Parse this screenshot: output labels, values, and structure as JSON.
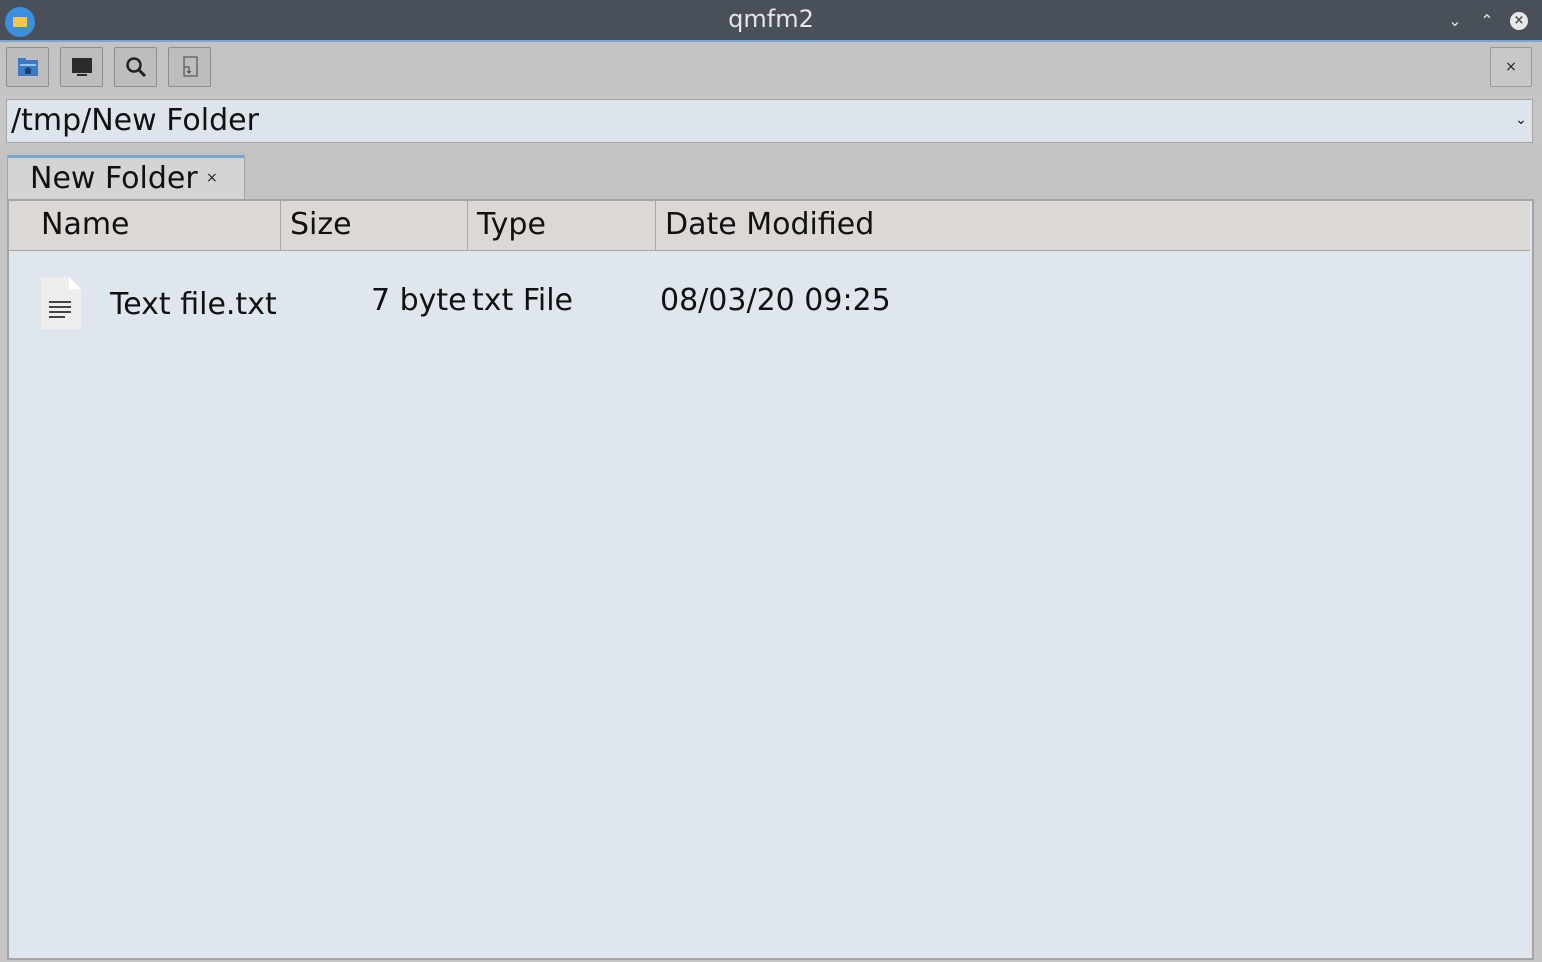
{
  "window": {
    "title": "qmfm2",
    "controls": {
      "minimize": "⌄",
      "maximize": "⌃",
      "close": "×"
    }
  },
  "toolbar": {
    "buttons": [
      {
        "icon": "home-folder-icon"
      },
      {
        "icon": "terminal-icon"
      },
      {
        "icon": "search-icon"
      },
      {
        "icon": "open-with-icon"
      }
    ],
    "close_pane_label": "×"
  },
  "pathbar": {
    "path": "/tmp/New Folder",
    "dropdown": "⌄"
  },
  "tabs": [
    {
      "label": "New Folder",
      "close": "×"
    }
  ],
  "fileview": {
    "columns": [
      "Name",
      "Size",
      "Type",
      "Date Modified"
    ],
    "rows": [
      {
        "name": "Text file.txt",
        "size": "7 byte",
        "type": "txt File",
        "modified": "08/03/20 09:25",
        "icon": "text-file-icon"
      }
    ]
  },
  "colors": {
    "titlebar": "#4a5059",
    "accent": "#79a6cf",
    "view_bg": "#dfe6ee"
  }
}
